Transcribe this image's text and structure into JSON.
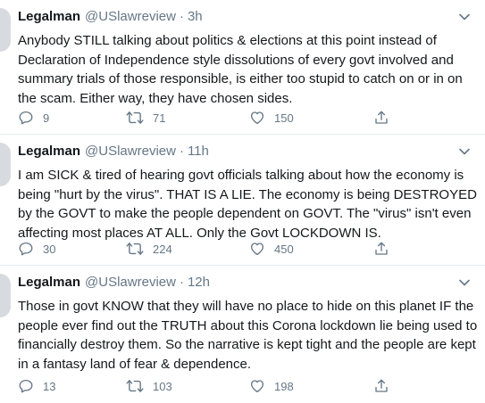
{
  "tweets": [
    {
      "name": "Legalman",
      "handle": "@USlawreview",
      "separator": "·",
      "time": "3h",
      "text": "Anybody STILL talking about politics & elections at this point instead of Declaration of Independence style dissolutions of every govt involved and summary trials of those responsible, is either too stupid to catch on or in on the scam. Either way, they have chosen sides.",
      "replies": "9",
      "retweets": "71",
      "likes": "150"
    },
    {
      "name": "Legalman",
      "handle": "@USlawreview",
      "separator": "·",
      "time": "11h",
      "text": "I am SICK & tired of hearing govt officials talking about how the economy is being \"hurt by the virus\". THAT IS A LIE. The economy is being DESTROYED by the GOVT to make the people dependent on GOVT. The \"virus\" isn't even affecting most places AT ALL. Only the Govt LOCKDOWN IS.",
      "replies": "30",
      "retweets": "224",
      "likes": "450"
    },
    {
      "name": "Legalman",
      "handle": "@USlawreview",
      "separator": "·",
      "time": "12h",
      "text": "Those in govt KNOW that they will have no place to hide on this planet IF the people ever find out the TRUTH about this Corona lockdown lie being used to financially destroy them. So the narrative is kept tight and the people are kept in a fantasy land of fear & dependence.",
      "replies": "13",
      "retweets": "103",
      "likes": "198"
    }
  ],
  "icons": {
    "reply": "reply-icon",
    "retweet": "retweet-icon",
    "like": "heart-icon",
    "share": "share-icon",
    "menu": "chevron-down-icon"
  },
  "colors": {
    "text": "#14171a",
    "secondary": "#657786",
    "divider": "#e6ecf0",
    "icon": "#657786"
  }
}
